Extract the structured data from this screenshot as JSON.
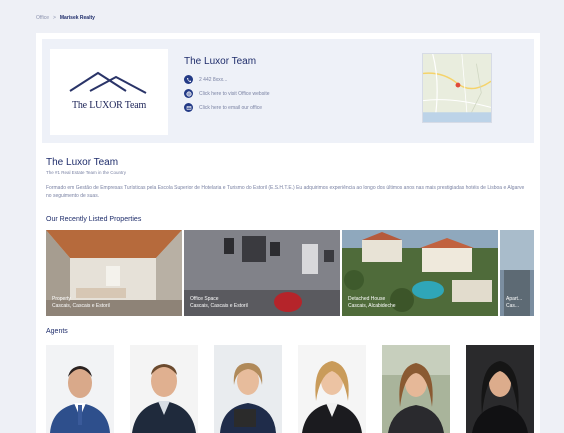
{
  "breadcrumb": {
    "parent": "Office",
    "separator": ">",
    "current": "Marisek Realty"
  },
  "header": {
    "logo_text": "The LUXOR Team",
    "title": "The Luxor Team",
    "contacts": [
      {
        "icon": "phone-icon",
        "text": "2 442 8xxx..."
      },
      {
        "icon": "globe-icon",
        "text": "Click here to visit Office website"
      },
      {
        "icon": "email-icon",
        "text": "Click here to email our office"
      }
    ]
  },
  "about": {
    "title": "The Luxor Team",
    "subtitle": "The #1 Real Estate Team in the Country",
    "description": "Formado em Gestão de Empresas Turísticas pela Escola Superior de Hotelaria e Turismo do Estoril (E.S.H.T.E.) Eu adquirimos experiência ao longo dos últimos anos nas mais prestigiadas hotéis de Lisboa e Algarve no seguimento de suas."
  },
  "properties_title": "Our Recently Listed Properties",
  "properties": [
    {
      "line1": "Property",
      "line2": "Cascais, Cascais e Estoril"
    },
    {
      "line1": "Office Space",
      "line2": "Cascais, Cascais e Estoril"
    },
    {
      "line1": "Detached House",
      "line2": "Cascais, Alcabideche"
    },
    {
      "line1": "Apart...",
      "line2": "Cas..."
    }
  ],
  "agents_title": "Agents",
  "colors": {
    "brand": "#233a86",
    "background": "#eef0f6",
    "panel": "#eef1f8"
  }
}
